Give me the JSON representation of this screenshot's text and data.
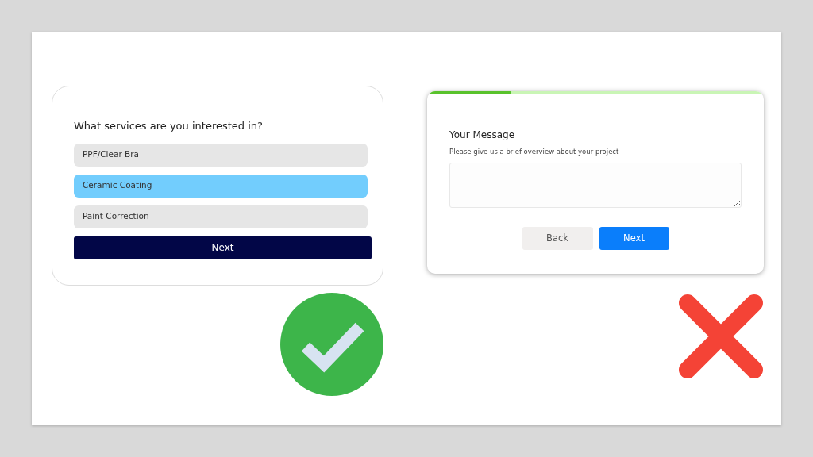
{
  "good_example": {
    "question": "What services are you interested in?",
    "options": [
      {
        "label": "PPF/Clear Bra",
        "selected": false
      },
      {
        "label": "Ceramic Coating",
        "selected": true
      },
      {
        "label": "Paint Correction",
        "selected": false
      }
    ],
    "next_button": "Next",
    "verdict": {
      "kind": "check"
    }
  },
  "bad_example": {
    "progress": {
      "level": 0.25
    },
    "title": "Your Message",
    "hint": "Please give us a brief overview about your project",
    "buttons": [
      {
        "label": "Back",
        "kind": "secondary"
      },
      {
        "label": "Next",
        "kind": "primary"
      }
    ],
    "verdict": {
      "kind": "cross"
    }
  }
}
